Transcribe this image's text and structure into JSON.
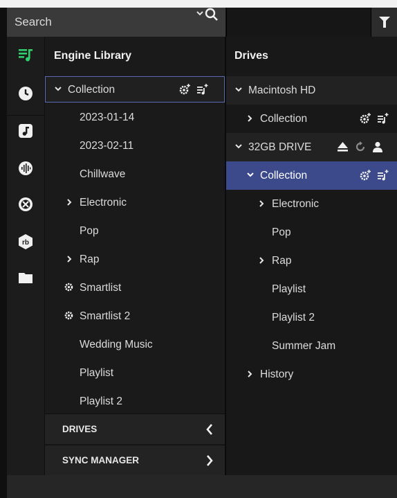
{
  "search": {
    "placeholder": "Search"
  },
  "icons": {
    "search": "search-icon",
    "filter": "filter-icon",
    "expand": "chevron-down-icon",
    "collapse": "chevron-right-icon",
    "settings": "gear-plus-icon",
    "add_playlist": "playlist-add-icon"
  },
  "rail": {
    "items": [
      {
        "name": "library",
        "icon": "library-icon",
        "active": true
      },
      {
        "name": "history",
        "icon": "clock-icon"
      },
      {
        "name": "music",
        "icon": "music-note-icon"
      },
      {
        "name": "soundcloud",
        "icon": "waveform-icon"
      },
      {
        "name": "tidal",
        "icon": "stream-icon"
      },
      {
        "name": "rekordbox",
        "icon": "rekordbox-icon"
      },
      {
        "name": "files",
        "icon": "folder-icon"
      }
    ],
    "accent": "#2ed06e"
  },
  "library": {
    "title": "Engine Library",
    "items": [
      {
        "label": "Collection"
      },
      {
        "label": "2023-01-14"
      },
      {
        "label": "2023-02-11"
      },
      {
        "label": "Chillwave"
      },
      {
        "label": "Electronic"
      },
      {
        "label": "Pop"
      },
      {
        "label": "Rap"
      },
      {
        "label": "Smartlist"
      },
      {
        "label": "Smartlist 2"
      },
      {
        "label": "Wedding Music"
      },
      {
        "label": "Playlist"
      },
      {
        "label": "Playlist 2"
      }
    ],
    "sections": [
      {
        "label": "DRIVES"
      },
      {
        "label": "SYNC MANAGER"
      }
    ]
  },
  "drives": {
    "title": "Drives",
    "items": [
      {
        "label": "Macintosh HD"
      },
      {
        "label": "Collection"
      },
      {
        "label": "32GB DRIVE"
      },
      {
        "label": "Collection"
      },
      {
        "label": "Electronic"
      },
      {
        "label": "Pop"
      },
      {
        "label": "Rap"
      },
      {
        "label": "Playlist"
      },
      {
        "label": "Playlist 2"
      },
      {
        "label": "Summer Jam"
      },
      {
        "label": "History"
      }
    ]
  },
  "colors": {
    "selected_fill": "#3c4a8c",
    "selected_outline": "#5a6ab4",
    "background": "#1a1a1a"
  }
}
